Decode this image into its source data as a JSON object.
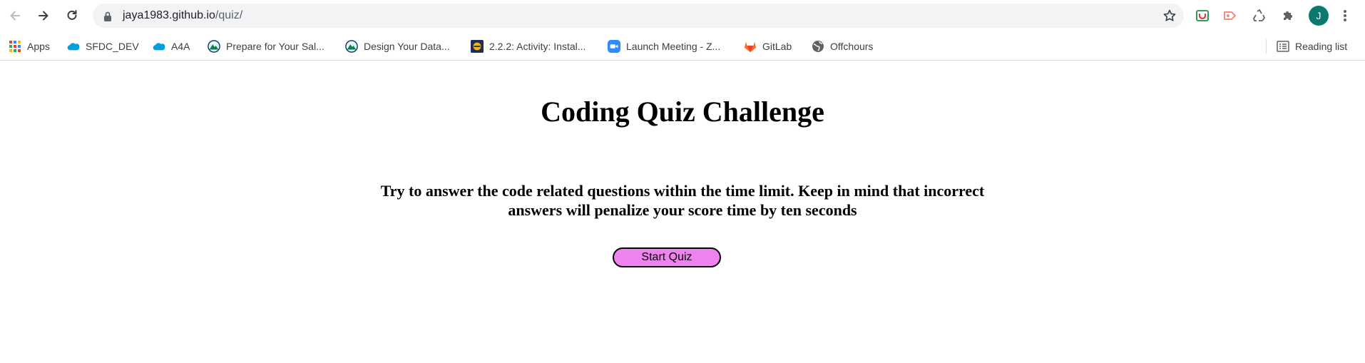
{
  "browser": {
    "url_host": "jaya1983.github.io",
    "url_path": "/quiz/",
    "profile_initial": "J",
    "icons": {
      "back": "back-arrow-icon",
      "forward": "forward-arrow-icon",
      "reload": "reload-icon",
      "lock": "lock-icon",
      "star": "star-icon",
      "menu": "kebab-menu-icon"
    }
  },
  "bookmarks": {
    "items": [
      {
        "label": "Apps",
        "icon": "apps-grid-icon"
      },
      {
        "label": "SFDC_DEV",
        "icon": "salesforce-cloud-icon"
      },
      {
        "label": "A4A",
        "icon": "salesforce-cloud-icon"
      },
      {
        "label": "Prepare for Your Sal...",
        "icon": "trailhead-icon"
      },
      {
        "label": "Design Your Data...",
        "icon": "trailhead-icon"
      },
      {
        "label": "2.2.2: Activity: Instal...",
        "icon": "course-badge-icon"
      },
      {
        "label": "Launch Meeting - Z...",
        "icon": "zoom-icon"
      },
      {
        "label": "GitLab",
        "icon": "gitlab-icon"
      },
      {
        "label": "Offchours",
        "icon": "globe-icon"
      }
    ],
    "reading_list": "Reading list"
  },
  "page": {
    "title": "Coding Quiz Challenge",
    "intro": "Try to answer the code related questions within the time limit. Keep in mind that incorrect answers will penalize your score time by ten seconds",
    "start_button": "Start Quiz"
  },
  "colors": {
    "start_button_bg": "#ee82ee",
    "profile_avatar": "#0b7a6e",
    "omnibox_bg": "#f1f3f4"
  }
}
